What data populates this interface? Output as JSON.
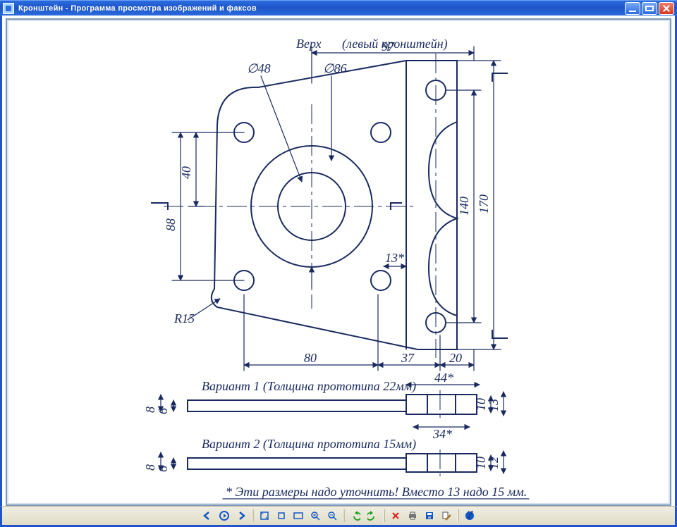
{
  "window": {
    "title": "Кронштейн - Программа просмотра изображений и факсов"
  },
  "drawing": {
    "header_left": "Верх",
    "header_right": "(левый кронштейн)",
    "dims": {
      "d48": "∅48",
      "d86": "∅86",
      "w97": "97",
      "h40": "40",
      "h88": "88",
      "h140": "140",
      "h170": "170",
      "r15": "R15",
      "w80": "80",
      "w37": "37",
      "w20": "20",
      "w13s": "13*",
      "w44s": "44*",
      "w34s": "34*",
      "t6": "6",
      "t8": "8",
      "t10": "10",
      "t12": "12",
      "t13": "13"
    },
    "variant1_label": "Вариант 1 (Толщина прототипа 22мм)",
    "variant2_label": "Вариант 2 (Толщина прототипа 15мм)",
    "footnote": "* Эти размеры надо уточнить!  Вместо 13 надо 15 мм."
  },
  "toolbar": {
    "prev": "prev",
    "play": "play",
    "next": "next",
    "fit": "fit",
    "actual": "actual",
    "slideshow": "slideshow",
    "zoomin": "zoomin",
    "zoomout": "zoomout",
    "rotleft": "rotleft",
    "rotright": "rotright",
    "delete": "delete",
    "print": "print",
    "save": "save",
    "edit": "edit",
    "help": "help"
  }
}
